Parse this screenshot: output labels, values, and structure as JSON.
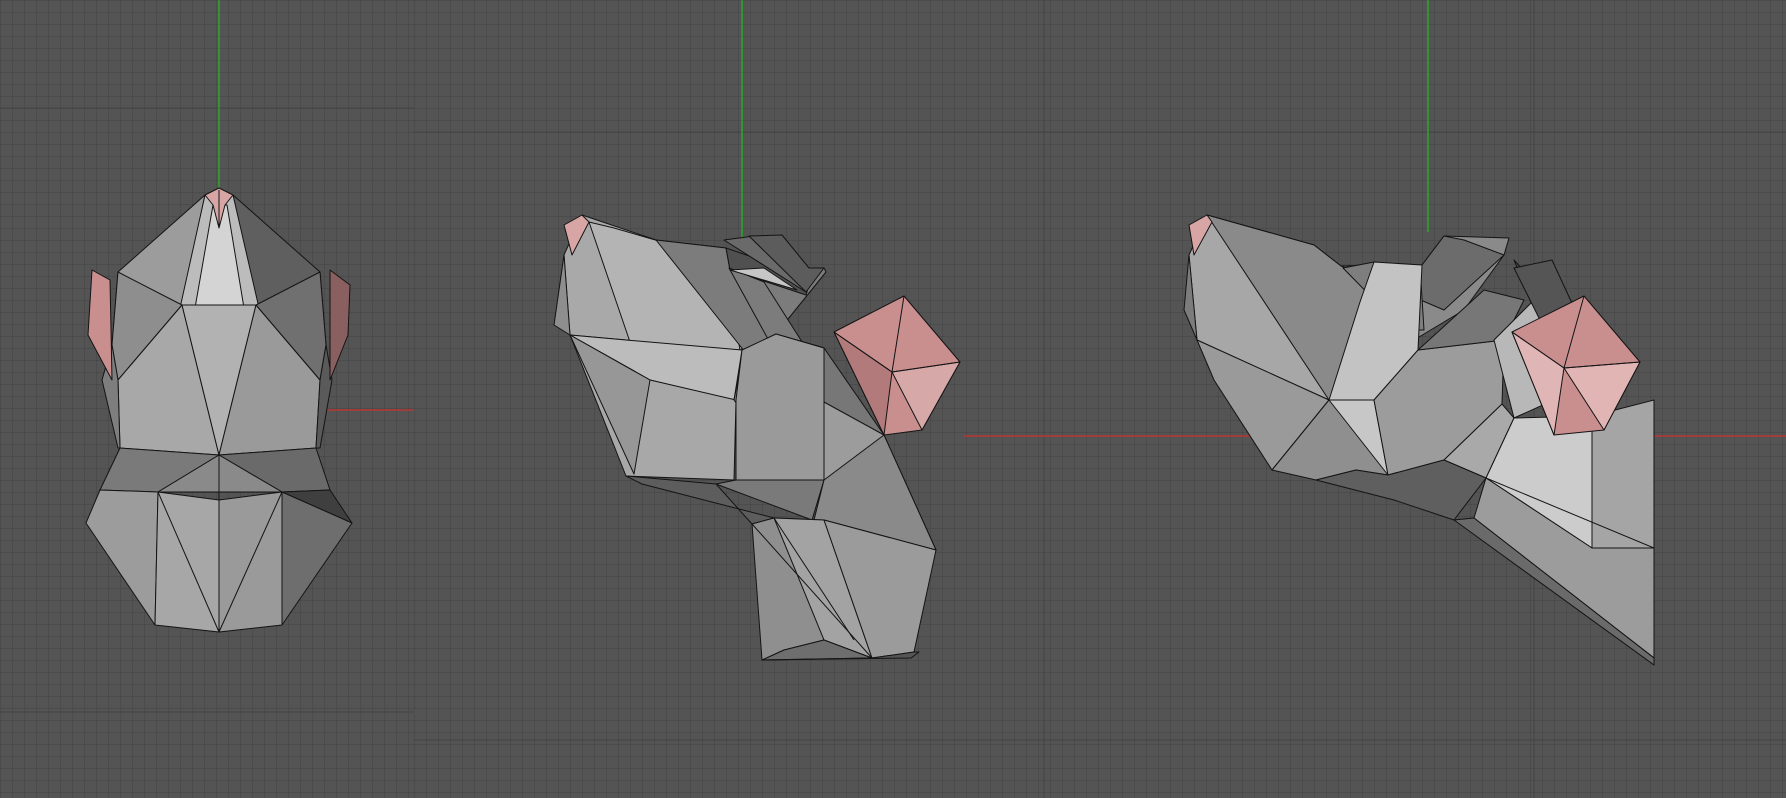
{
  "app": {
    "type": "3d-modeling-viewports"
  },
  "colors": {
    "background": "#545454",
    "grid_minor": "#4d4d4d",
    "grid_major": "#454545",
    "axis_y": "#2aa52a",
    "axis_x": "#b83434",
    "mesh_light": "#bdbdbd",
    "mesh_mid": "#9f9f9f",
    "mesh_dark": "#7a7a7a",
    "mesh_shadow": "#4a4a4a",
    "selected_face": "#c98f8f",
    "selected_face_light": "#e0b0b0",
    "edge": "#141414"
  },
  "viewports": [
    {
      "name": "front-view",
      "object": "low-poly-head-front"
    },
    {
      "name": "side-view-a",
      "object": "low-poly-head-side-a"
    },
    {
      "name": "side-view-b",
      "object": "low-poly-head-side-b"
    }
  ]
}
